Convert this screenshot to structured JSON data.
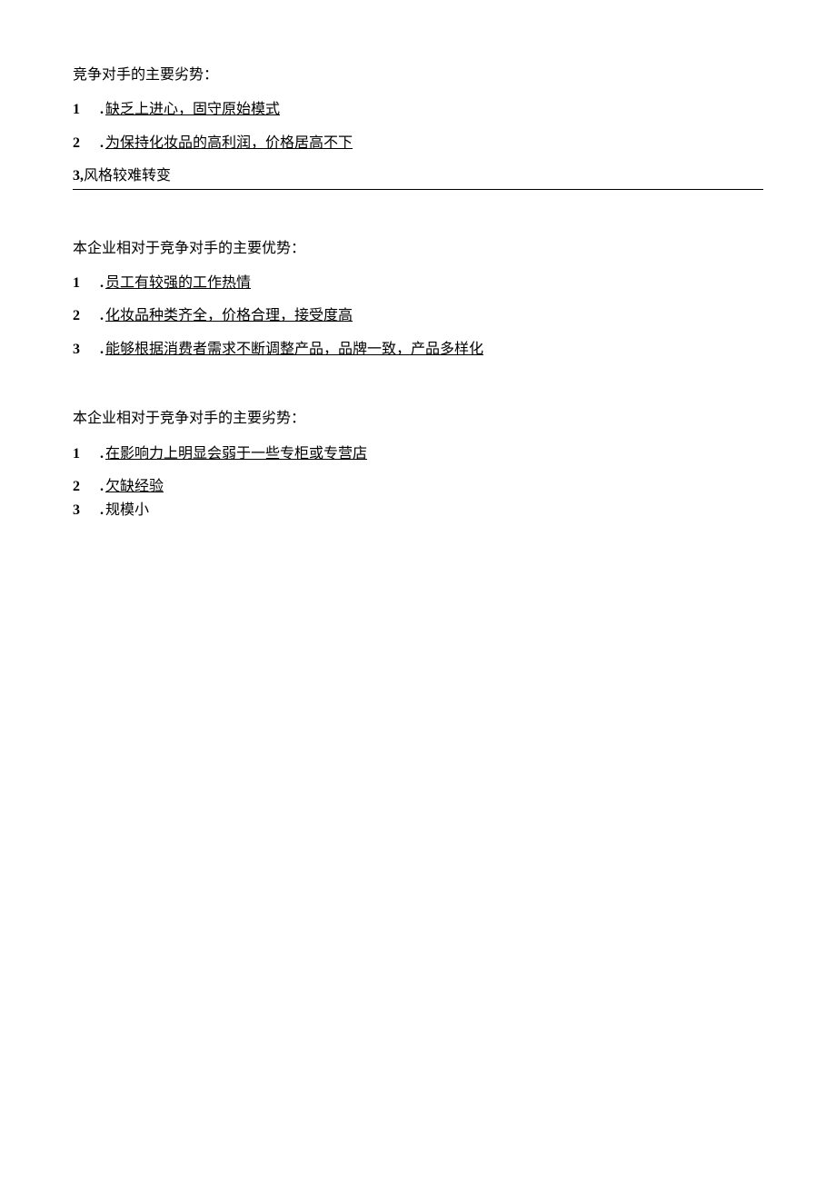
{
  "sections": [
    {
      "heading": "竞争对手的主要劣势：",
      "items": [
        {
          "num": "1",
          "dot": ".",
          "text": "缺乏上进心，固守原始模式",
          "underline": true,
          "fullLine": false
        },
        {
          "num": "2",
          "dot": ".",
          "text": "为保持化妆品的高利润，价格居高不下",
          "underline": true,
          "fullLine": false
        },
        {
          "num": "3,",
          "dot": "",
          "text": "风格较难转变",
          "underline": false,
          "fullLine": true
        }
      ]
    },
    {
      "heading": "本企业相对于竞争对手的主要优势：",
      "items": [
        {
          "num": "1",
          "dot": ".",
          "text": "员工有较强的工作热情",
          "underline": true,
          "fullLine": false
        },
        {
          "num": "2",
          "dot": ".",
          "text": "化妆品种类齐全，价格合理，接受度高",
          "underline": true,
          "fullLine": false
        },
        {
          "num": "3",
          "dot": ".",
          "text": "能够根据消费者需求不断调整产品，品牌一致，产品多样化",
          "underline": true,
          "fullLine": false
        }
      ]
    },
    {
      "heading": "本企业相对于竞争对手的主要劣势：",
      "items": [
        {
          "num": "1",
          "dot": ".",
          "text": "在影响力上明显会弱于一些专柜或专营店",
          "underline": true,
          "fullLine": false
        },
        {
          "num": "2",
          "dot": ".",
          "text": "欠缺经验",
          "underline": true,
          "fullLine": false,
          "tight": true
        },
        {
          "num": "3",
          "dot": ".",
          "text": "规模小",
          "underline": false,
          "fullLine": false,
          "tight": true
        }
      ]
    }
  ]
}
